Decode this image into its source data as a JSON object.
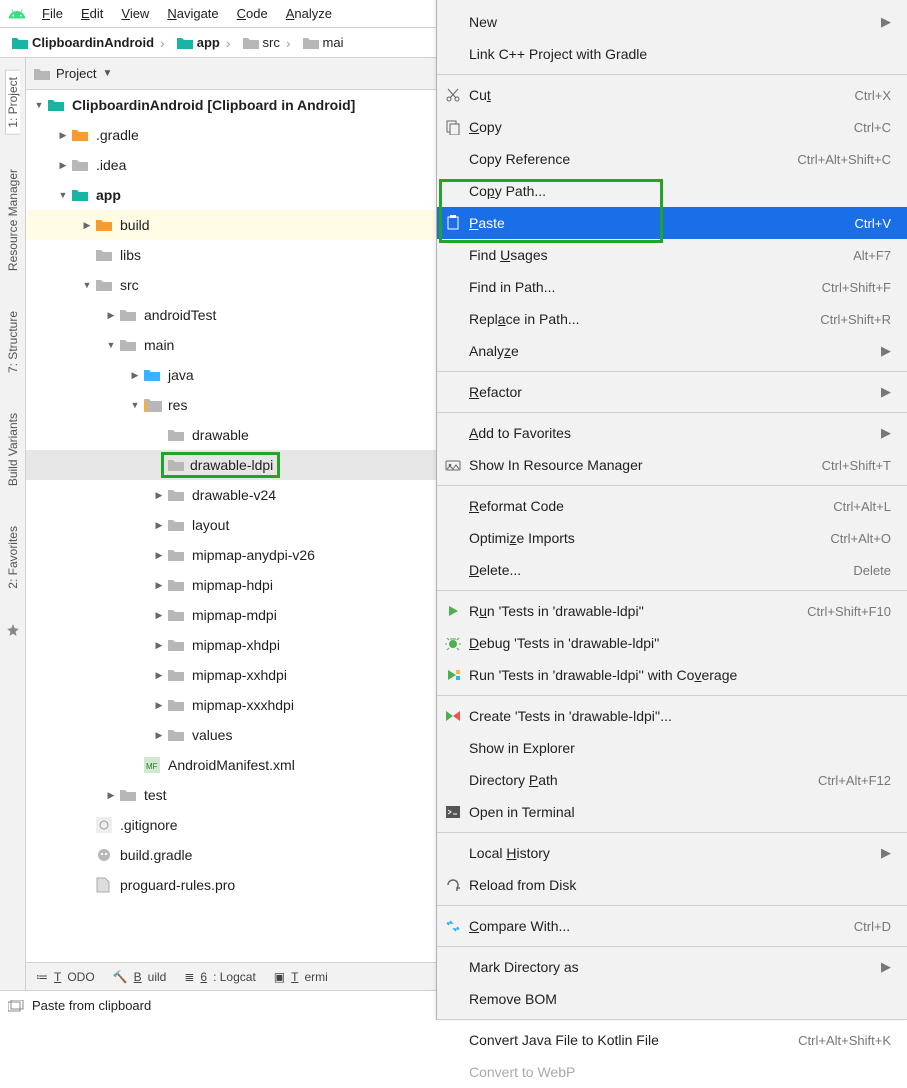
{
  "menubar": [
    "File",
    "Edit",
    "View",
    "Navigate",
    "Code",
    "Analyze"
  ],
  "breadcrumb": [
    {
      "label": "ClipboardinAndroid",
      "bold": true,
      "icon": "teal"
    },
    {
      "label": "app",
      "bold": true,
      "icon": "teal"
    },
    {
      "label": "src",
      "bold": false,
      "icon": "grey"
    },
    {
      "label": "mai",
      "bold": false,
      "icon": "grey"
    }
  ],
  "left_tabs": [
    {
      "label": "1: Project",
      "active": true
    },
    {
      "label": "Resource Manager",
      "active": false
    },
    {
      "label": "7: Structure",
      "active": false
    },
    {
      "label": "Build Variants",
      "active": false
    },
    {
      "label": "2: Favorites",
      "active": false
    }
  ],
  "panel_title": "Project",
  "tree": [
    {
      "d": 0,
      "tw": "down",
      "ic": "teal",
      "lbl": "ClipboardinAndroid",
      "suf": " [Clipboard in Android]",
      "bold": true
    },
    {
      "d": 1,
      "tw": "right",
      "ic": "orange",
      "lbl": ".gradle"
    },
    {
      "d": 1,
      "tw": "right",
      "ic": "grey",
      "lbl": ".idea"
    },
    {
      "d": 1,
      "tw": "down",
      "ic": "teal",
      "lbl": "app",
      "bold": true
    },
    {
      "d": 2,
      "tw": "right",
      "ic": "orange",
      "lbl": "build",
      "yellow": true
    },
    {
      "d": 2,
      "tw": "",
      "ic": "grey",
      "lbl": "libs"
    },
    {
      "d": 2,
      "tw": "down",
      "ic": "grey",
      "lbl": "src"
    },
    {
      "d": 3,
      "tw": "right",
      "ic": "grey",
      "lbl": "androidTest"
    },
    {
      "d": 3,
      "tw": "down",
      "ic": "grey",
      "lbl": "main"
    },
    {
      "d": 4,
      "tw": "right",
      "ic": "blue",
      "lbl": "java"
    },
    {
      "d": 4,
      "tw": "down",
      "ic": "res",
      "lbl": "res"
    },
    {
      "d": 5,
      "tw": "",
      "ic": "grey",
      "lbl": "drawable"
    },
    {
      "d": 5,
      "tw": "",
      "ic": "grey",
      "lbl": "drawable-ldpi",
      "selected": true,
      "box": true
    },
    {
      "d": 5,
      "tw": "right",
      "ic": "grey",
      "lbl": "drawable-v24"
    },
    {
      "d": 5,
      "tw": "right",
      "ic": "grey",
      "lbl": "layout"
    },
    {
      "d": 5,
      "tw": "right",
      "ic": "grey",
      "lbl": "mipmap-anydpi-v26"
    },
    {
      "d": 5,
      "tw": "right",
      "ic": "grey",
      "lbl": "mipmap-hdpi"
    },
    {
      "d": 5,
      "tw": "right",
      "ic": "grey",
      "lbl": "mipmap-mdpi"
    },
    {
      "d": 5,
      "tw": "right",
      "ic": "grey",
      "lbl": "mipmap-xhdpi"
    },
    {
      "d": 5,
      "tw": "right",
      "ic": "grey",
      "lbl": "mipmap-xxhdpi"
    },
    {
      "d": 5,
      "tw": "right",
      "ic": "grey",
      "lbl": "mipmap-xxxhdpi"
    },
    {
      "d": 5,
      "tw": "right",
      "ic": "grey",
      "lbl": "values"
    },
    {
      "d": 4,
      "tw": "",
      "ic": "mf",
      "lbl": "AndroidManifest.xml"
    },
    {
      "d": 3,
      "tw": "right",
      "ic": "grey",
      "lbl": "test"
    },
    {
      "d": 2,
      "tw": "",
      "ic": "gi",
      "lbl": ".gitignore"
    },
    {
      "d": 2,
      "tw": "",
      "ic": "gr",
      "lbl": "build.gradle"
    },
    {
      "d": 2,
      "tw": "",
      "ic": "file",
      "lbl": "proguard-rules.pro"
    }
  ],
  "bottom_tools": [
    {
      "ic": "todo",
      "label": "TODO"
    },
    {
      "ic": "build",
      "label": "Build"
    },
    {
      "ic": "logcat",
      "label": "6: Logcat"
    },
    {
      "ic": "term",
      "label": "Termi"
    }
  ],
  "status": "Paste from clipboard",
  "ctx": [
    {
      "t": "item",
      "label": "New",
      "sub": true
    },
    {
      "t": "item",
      "label": "Link C++ Project with Gradle"
    },
    {
      "t": "sep"
    },
    {
      "t": "item",
      "ic": "cut",
      "label": "Cut",
      "u": "t",
      "sc": "Ctrl+X"
    },
    {
      "t": "item",
      "ic": "copy",
      "label": "Copy",
      "u": "C",
      "sc": "Ctrl+C"
    },
    {
      "t": "item",
      "label": "Copy Reference",
      "sc": "Ctrl+Alt+Shift+C"
    },
    {
      "t": "item",
      "label": "Copy Path...",
      "u": "P"
    },
    {
      "t": "item",
      "ic": "paste",
      "label": "Paste",
      "u": "P",
      "sc": "Ctrl+V",
      "hover": true
    },
    {
      "t": "item",
      "label": "Find Usages",
      "u": "U",
      "sc": "Alt+F7"
    },
    {
      "t": "item",
      "label": "Find in Path...",
      "sc": "Ctrl+Shift+F"
    },
    {
      "t": "item",
      "label": "Replace in Path...",
      "u": "a",
      "sc": "Ctrl+Shift+R"
    },
    {
      "t": "item",
      "label": "Analyze",
      "u": "z",
      "sub": true
    },
    {
      "t": "sep"
    },
    {
      "t": "item",
      "label": "Refactor",
      "u": "R",
      "sub": true
    },
    {
      "t": "sep"
    },
    {
      "t": "item",
      "label": "Add to Favorites",
      "u": "a",
      "sub": true
    },
    {
      "t": "item",
      "ic": "resmgr",
      "label": "Show In Resource Manager",
      "sc": "Ctrl+Shift+T"
    },
    {
      "t": "sep"
    },
    {
      "t": "item",
      "label": "Reformat Code",
      "u": "R",
      "sc": "Ctrl+Alt+L"
    },
    {
      "t": "item",
      "label": "Optimize Imports",
      "u": "z",
      "sc": "Ctrl+Alt+O"
    },
    {
      "t": "item",
      "label": "Delete...",
      "u": "D",
      "sc": "Delete"
    },
    {
      "t": "sep"
    },
    {
      "t": "item",
      "ic": "run",
      "label": "Run 'Tests in 'drawable-ldpi''",
      "u": "u",
      "sc": "Ctrl+Shift+F10"
    },
    {
      "t": "item",
      "ic": "debug",
      "label": "Debug 'Tests in 'drawable-ldpi''",
      "u": "D"
    },
    {
      "t": "item",
      "ic": "cover",
      "label": "Run 'Tests in 'drawable-ldpi'' with Coverage",
      "u": "v"
    },
    {
      "t": "sep"
    },
    {
      "t": "item",
      "ic": "create",
      "label": "Create 'Tests in 'drawable-ldpi''..."
    },
    {
      "t": "item",
      "label": "Show in Explorer"
    },
    {
      "t": "item",
      "label": "Directory Path",
      "u": "P",
      "sc": "Ctrl+Alt+F12"
    },
    {
      "t": "item",
      "ic": "term",
      "label": "Open in Terminal"
    },
    {
      "t": "sep"
    },
    {
      "t": "item",
      "label": "Local History",
      "u": "H",
      "sub": true
    },
    {
      "t": "item",
      "ic": "reload",
      "label": "Reload from Disk"
    },
    {
      "t": "sep"
    },
    {
      "t": "item",
      "ic": "compare",
      "label": "Compare With...",
      "u": "C",
      "sc": "Ctrl+D"
    },
    {
      "t": "sep"
    },
    {
      "t": "item",
      "label": "Mark Directory as",
      "sub": true
    },
    {
      "t": "item",
      "label": "Remove BOM"
    },
    {
      "t": "sep"
    },
    {
      "t": "item",
      "label": "Convert Java File to Kotlin File",
      "sc": "Ctrl+Alt+Shift+K"
    },
    {
      "t": "item",
      "label": "Convert to WebP",
      "dim": true
    }
  ],
  "ctx_highlight_index": 7
}
